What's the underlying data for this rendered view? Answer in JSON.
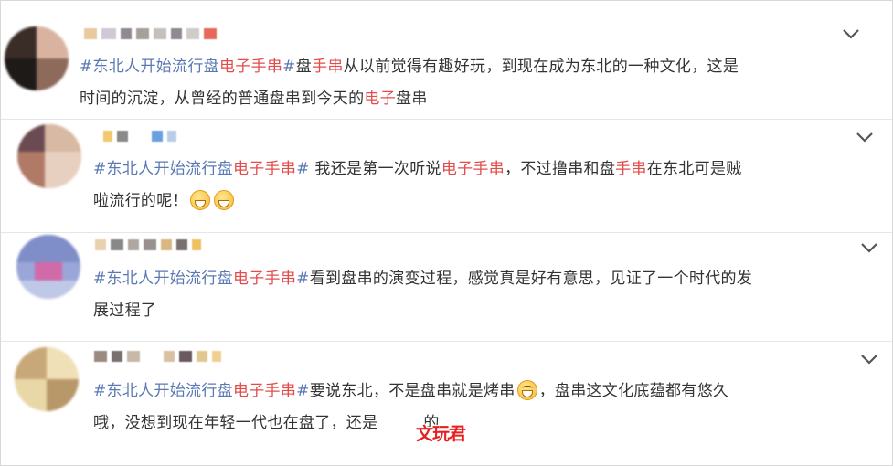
{
  "colors": {
    "hashtag": "#5a78b4",
    "highlight": "#e44b4b",
    "text": "#333333",
    "watermark": "#e62020"
  },
  "icons": {
    "expand": "chevron-down-icon",
    "emoji_grin": "grinning-emoji-icon",
    "emoji_laugh": "laughing-emoji-icon"
  },
  "comments": [
    {
      "hashtag_pre": "#东北人开始流行盘",
      "hashtag_hl": "电子手串",
      "hashtag_post": "#",
      "lines": [
        [
          {
            "t": "盘"
          },
          {
            "t": "手串",
            "hl": true
          },
          {
            "t": "从以前觉得有趣好玩，到现在成为东北的一种文化，这是"
          }
        ],
        [
          {
            "t": "时间的沉淀，从曾经的普通盘串到今天的"
          },
          {
            "t": "电子",
            "hl": true
          },
          {
            "t": "盘串"
          }
        ]
      ]
    },
    {
      "hashtag_pre": "#东北人开始流行盘",
      "hashtag_hl": "电子手串",
      "hashtag_post": "#",
      "lines": [
        [
          {
            "t": " 我还是第一次听说"
          },
          {
            "t": "电子手串",
            "hl": true
          },
          {
            "t": "，不过撸串和盘"
          },
          {
            "t": "手串",
            "hl": true
          },
          {
            "t": "在东北可是贼"
          }
        ],
        [
          {
            "t": "啦流行的呢！"
          }
        ]
      ]
    },
    {
      "hashtag_pre": "#东北人开始流行盘",
      "hashtag_hl": "电子手串",
      "hashtag_post": "#",
      "lines": [
        [
          {
            "t": "看到盘串的演变过程，感觉真是好有意思，见证了一个时代的发"
          }
        ],
        [
          {
            "t": "展过程了"
          }
        ]
      ]
    },
    {
      "hashtag_pre": "#东北人开始流行盘",
      "hashtag_hl": "电子手串",
      "hashtag_post": "#",
      "lines": [
        [
          {
            "t": "要说东北，不是盘串就是烤串"
          }
        ],
        [
          {
            "t": "哦，没想到现在年轻一代也在盘了，还是"
          }
        ]
      ],
      "after_emoji": "，盘串这文化底蕴都有悠久",
      "line2_tail": "的"
    }
  ],
  "watermark_text": "文玩君"
}
